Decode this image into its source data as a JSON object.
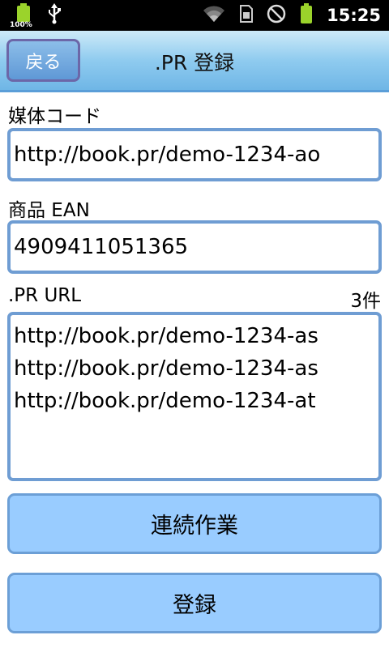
{
  "status_bar": {
    "battery_small_label": "100%",
    "time": "15:25",
    "icons": [
      "battery-full-icon",
      "usb-icon",
      "wifi-icon",
      "sim-card-icon",
      "no-signal-icon",
      "battery-icon"
    ]
  },
  "header": {
    "back_label": "戻る",
    "title": ".PR 登録"
  },
  "form": {
    "media_code": {
      "label": "媒体コード",
      "value": "http://book.pr/demo-1234-ao"
    },
    "ean": {
      "label": "商品 EAN",
      "value": "4909411051365"
    },
    "pr_url": {
      "label": ".PR URL",
      "count": "3件",
      "lines": [
        "http://book.pr/demo-1234-as",
        "http://book.pr/demo-1234-as",
        "http://book.pr/demo-1234-at"
      ]
    }
  },
  "buttons": {
    "continuous_label": "連続作業",
    "register_label": "登録"
  },
  "colors": {
    "accent_border": "#6f9dd3",
    "button_fill": "#99ccff",
    "battery_green": "#9bd32b"
  }
}
